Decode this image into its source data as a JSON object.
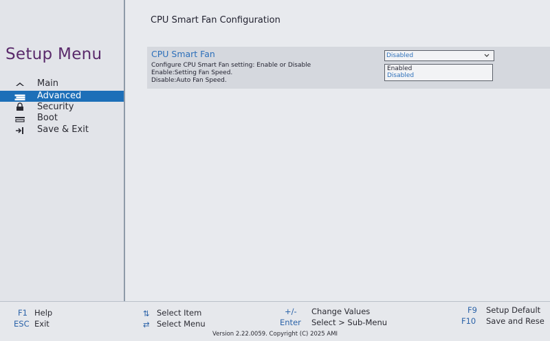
{
  "sidebar": {
    "title": "Setup Menu",
    "items": [
      {
        "label": "Main",
        "icon": "home-icon"
      },
      {
        "label": "Advanced",
        "icon": "advanced-icon",
        "active": true
      },
      {
        "label": "Security",
        "icon": "lock-icon"
      },
      {
        "label": "Boot",
        "icon": "boot-icon"
      },
      {
        "label": "Save & Exit",
        "icon": "exit-icon"
      }
    ]
  },
  "main": {
    "title": "CPU Smart Fan Configuration",
    "setting": {
      "label": "CPU Smart Fan",
      "help": [
        "Configure CPU Smart Fan setting: Enable or Disable",
        "Enable:Setting Fan Speed.",
        "Disable:Auto Fan Speed."
      ],
      "value": "Disabled",
      "options": [
        "Enabled",
        "Disabled"
      ]
    }
  },
  "footer": {
    "keys": [
      {
        "key": "F1",
        "desc": "Help"
      },
      {
        "key": "ESC",
        "desc": "Exit"
      },
      {
        "key": "⇅",
        "desc": "Select Item"
      },
      {
        "key": "⇄",
        "desc": "Select Menu"
      },
      {
        "key": "+/-",
        "desc": "Change Values"
      },
      {
        "key": "Enter",
        "desc": "Select > Sub-Menu"
      },
      {
        "key": "F9",
        "desc": "Setup Default"
      },
      {
        "key": "F10",
        "desc": "Save and Rese"
      }
    ],
    "version": "Version 2.22.0059. Copyright (C) 2025 AMI"
  },
  "colors": {
    "accent": "#1d6fb8",
    "title_purple": "#5a2a6b",
    "value_blue": "#2c6fba",
    "background": "#e6e8ec"
  }
}
